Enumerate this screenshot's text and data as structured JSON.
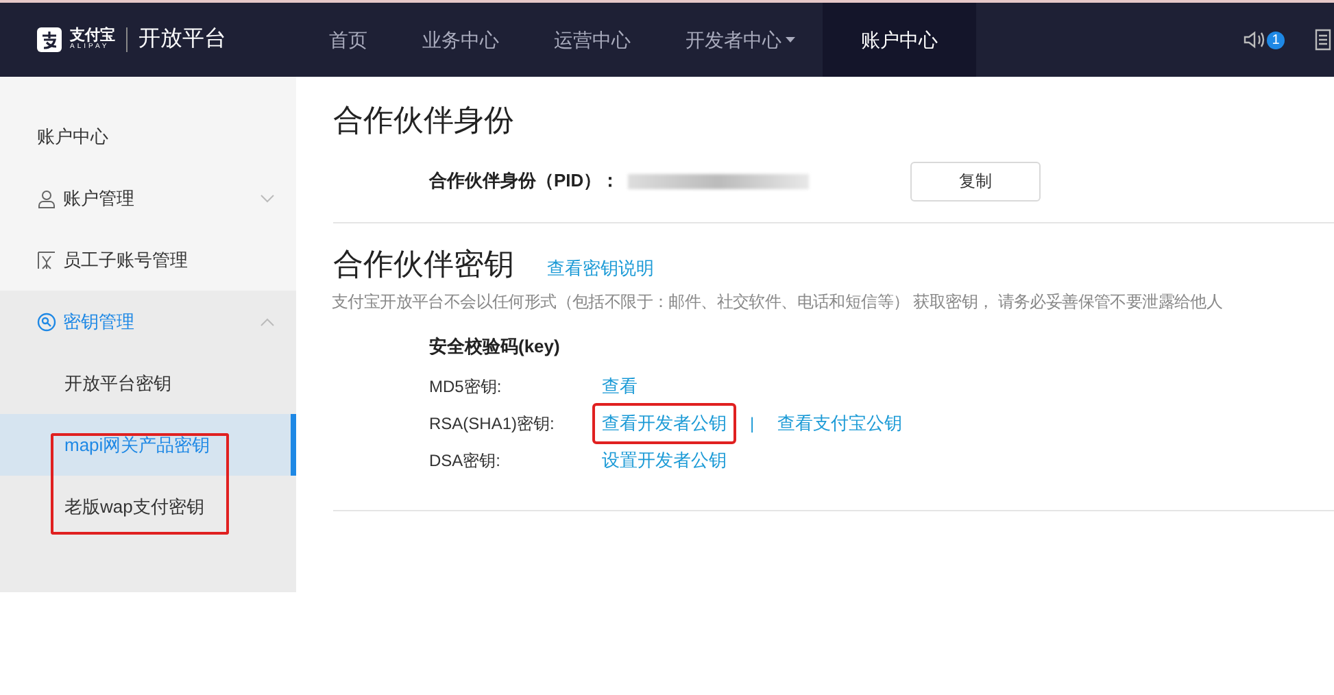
{
  "header": {
    "logo_mark": "支付宝",
    "logo_sub": "ALIPAY",
    "logo_title": "开放平台",
    "nav": [
      {
        "label": "首页",
        "selected": false,
        "dropdown": false
      },
      {
        "label": "业务中心",
        "selected": false,
        "dropdown": false
      },
      {
        "label": "运营中心",
        "selected": false,
        "dropdown": false
      },
      {
        "label": "开发者中心",
        "selected": false,
        "dropdown": true
      },
      {
        "label": "账户中心",
        "selected": true,
        "dropdown": false
      }
    ],
    "notification_count": "1"
  },
  "sidebar": {
    "title": "账户中心",
    "items": [
      {
        "label": "账户管理",
        "kind": "user",
        "expanded": false
      },
      {
        "label": "员工子账号管理",
        "kind": "staff"
      },
      {
        "label": "密钥管理",
        "kind": "key",
        "expanded": true,
        "children": [
          {
            "label": "开放平台密钥",
            "selected": false,
            "highlight": false
          },
          {
            "label": "mapi网关产品密钥",
            "selected": true,
            "highlight": true
          },
          {
            "label": "老版wap支付密钥",
            "selected": false,
            "highlight": true
          }
        ]
      }
    ]
  },
  "partner_identity": {
    "title": "合作伙伴身份",
    "pid_label": "合作伙伴身份（PID）：",
    "copy_button": "复制"
  },
  "partner_key": {
    "title": "合作伙伴密钥",
    "help_link": "查看密钥说明",
    "notice": "支付宝开放平台不会以任何形式（包括不限于：邮件、社交软件、电话和短信等） 获取密钥， 请务必妥善保管不要泄露给他人",
    "section_title": "安全校验码(key)",
    "rows": [
      {
        "label": "MD5密钥:",
        "links": [
          {
            "text": "查看",
            "highlight": false
          }
        ]
      },
      {
        "label": "RSA(SHA1)密钥:",
        "links": [
          {
            "text": "查看开发者公钥",
            "highlight": true
          },
          {
            "text": "查看支付宝公钥",
            "highlight": false
          }
        ],
        "separator": "|"
      },
      {
        "label": "DSA密钥:",
        "links": [
          {
            "text": "设置开发者公钥",
            "highlight": false
          }
        ]
      }
    ]
  }
}
